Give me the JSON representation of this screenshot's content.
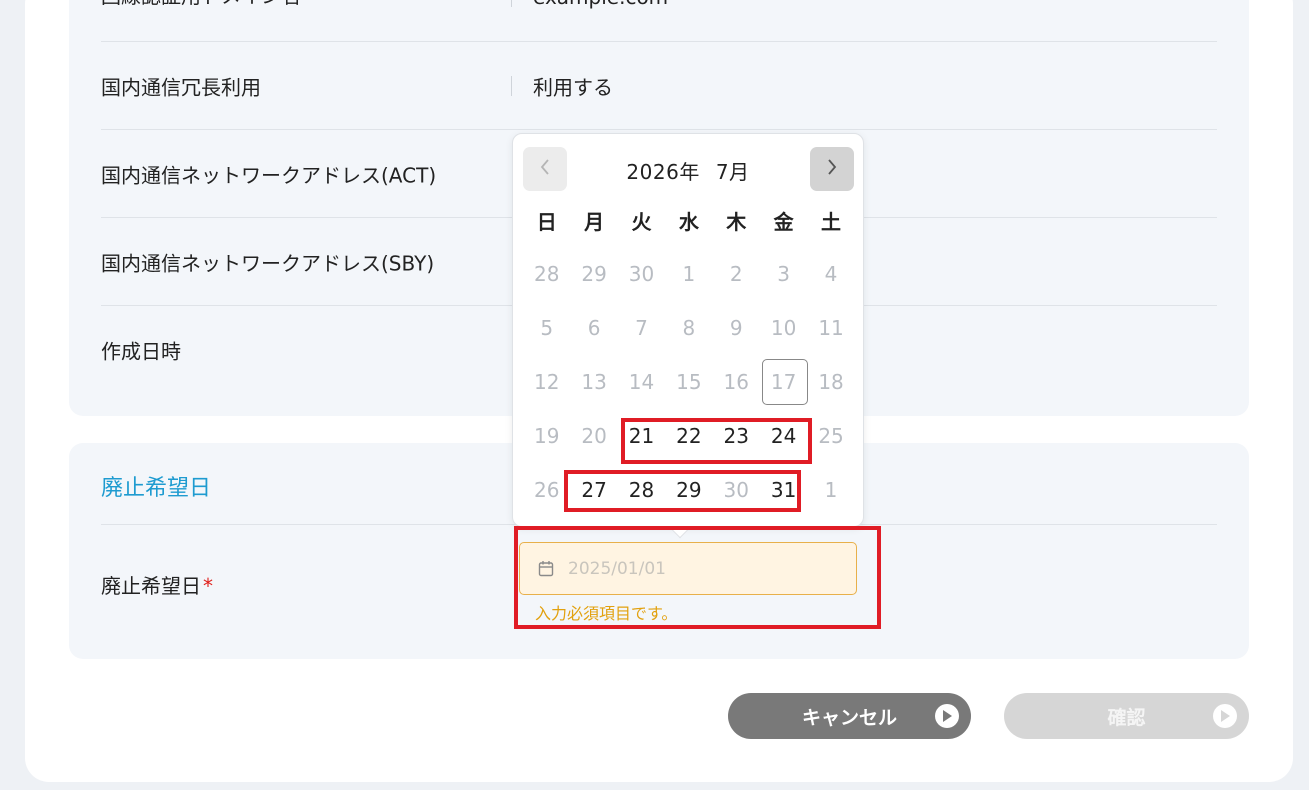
{
  "info_rows": [
    {
      "label": "回線認証用ドメイン名",
      "value": "example.com"
    },
    {
      "label": "国内通信冗長利用",
      "value": "利用する"
    },
    {
      "label": "国内通信ネットワークアドレス(ACT)",
      "value": ""
    },
    {
      "label": "国内通信ネットワークアドレス(SBY)",
      "value": ""
    },
    {
      "label": "作成日時",
      "value": ""
    }
  ],
  "abolish": {
    "section_title": "廃止希望日",
    "field_label": "廃止希望日",
    "required_mark": "*",
    "input_placeholder": "2025/01/01",
    "input_value": "",
    "error_message": "入力必須項目です。"
  },
  "calendar": {
    "year_label": "2026年",
    "month_label": "7月",
    "weekdays": [
      "日",
      "月",
      "火",
      "水",
      "木",
      "金",
      "土"
    ],
    "days": [
      {
        "label": "28",
        "enabled": false
      },
      {
        "label": "29",
        "enabled": false
      },
      {
        "label": "30",
        "enabled": false
      },
      {
        "label": "1",
        "enabled": false
      },
      {
        "label": "2",
        "enabled": false
      },
      {
        "label": "3",
        "enabled": false
      },
      {
        "label": "4",
        "enabled": false
      },
      {
        "label": "5",
        "enabled": false
      },
      {
        "label": "6",
        "enabled": false
      },
      {
        "label": "7",
        "enabled": false
      },
      {
        "label": "8",
        "enabled": false
      },
      {
        "label": "9",
        "enabled": false
      },
      {
        "label": "10",
        "enabled": false
      },
      {
        "label": "11",
        "enabled": false
      },
      {
        "label": "12",
        "enabled": false
      },
      {
        "label": "13",
        "enabled": false
      },
      {
        "label": "14",
        "enabled": false
      },
      {
        "label": "15",
        "enabled": false
      },
      {
        "label": "16",
        "enabled": false
      },
      {
        "label": "17",
        "enabled": false,
        "today": true
      },
      {
        "label": "18",
        "enabled": false
      },
      {
        "label": "19",
        "enabled": false
      },
      {
        "label": "20",
        "enabled": false
      },
      {
        "label": "21",
        "enabled": true
      },
      {
        "label": "22",
        "enabled": true
      },
      {
        "label": "23",
        "enabled": true
      },
      {
        "label": "24",
        "enabled": true
      },
      {
        "label": "25",
        "enabled": false
      },
      {
        "label": "26",
        "enabled": false
      },
      {
        "label": "27",
        "enabled": true
      },
      {
        "label": "28",
        "enabled": true
      },
      {
        "label": "29",
        "enabled": true
      },
      {
        "label": "30",
        "enabled": false
      },
      {
        "label": "31",
        "enabled": true
      },
      {
        "label": "1",
        "enabled": false
      }
    ]
  },
  "buttons": {
    "cancel_label": "キャンセル",
    "confirm_label": "確認"
  },
  "colors": {
    "accent": "#1e9bd0",
    "error": "#e2a10f",
    "highlight": "#e01c25"
  }
}
